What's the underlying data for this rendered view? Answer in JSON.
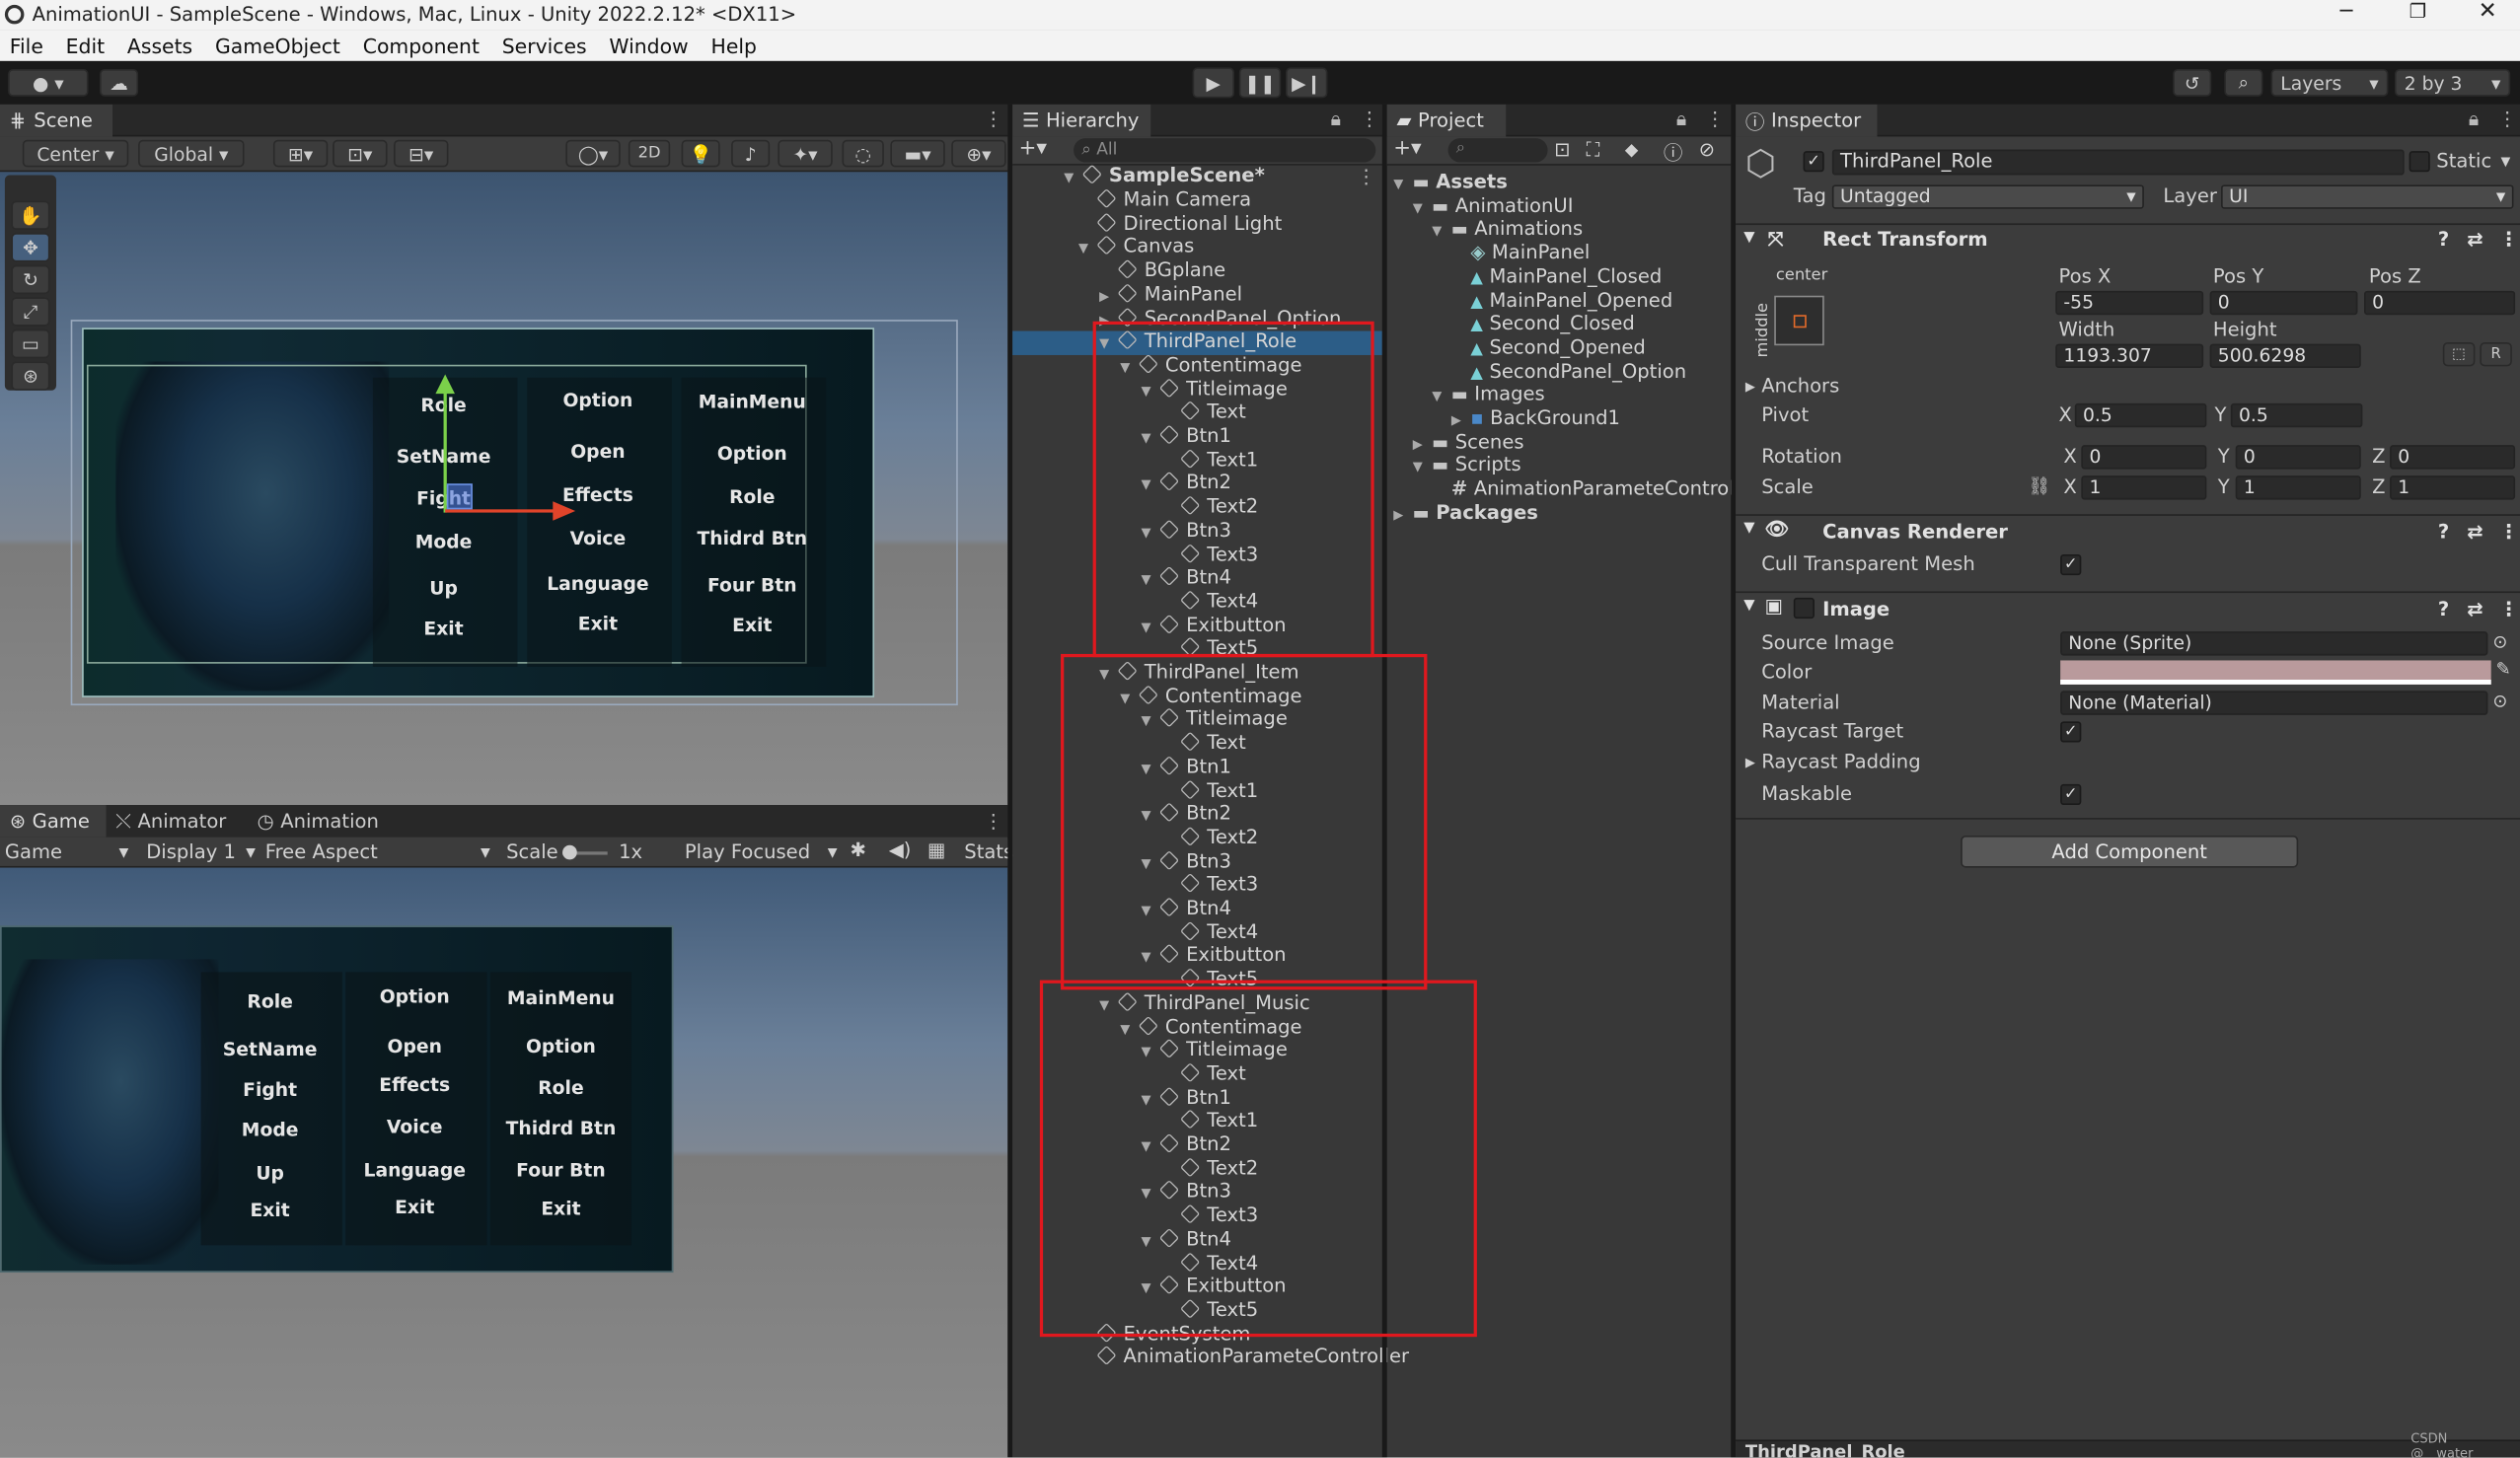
{
  "window": {
    "title": "AnimationUI - SampleScene - Windows, Mac, Linux - Unity 2022.2.12* <DX11>"
  },
  "menu": [
    "File",
    "Edit",
    "Assets",
    "GameObject",
    "Component",
    "Services",
    "Window",
    "Help"
  ],
  "toolbar": {
    "layers": "Layers",
    "layout": "2 by 3"
  },
  "scene": {
    "tab": "Scene",
    "pivot": "Center",
    "space": "Global",
    "mode2d": "2D"
  },
  "scene_ui": {
    "col1": [
      "Role",
      "SetName",
      "Fight",
      "Mode",
      "Up",
      "Exit"
    ],
    "col2": [
      "Option",
      "Open",
      "Effects",
      "Voice",
      "Language",
      "Exit"
    ],
    "col3": [
      "MainMenu",
      "Option",
      "Role",
      "Thidrd Btn",
      "Four Btn",
      "Exit"
    ]
  },
  "game": {
    "tabs": [
      "Game",
      "Animator",
      "Animation"
    ],
    "mode": "Game",
    "display": "Display 1",
    "aspect": "Free Aspect",
    "scale_label": "Scale",
    "scale_value": "1x",
    "play": "Play Focused",
    "stats": "Stats"
  },
  "hierarchy": {
    "tab": "Hierarchy",
    "search": "All",
    "scene": "SampleScene*",
    "items": [
      "Main Camera",
      "Directional Light",
      "Canvas",
      "BGplane",
      "MainPanel",
      "SecondPanel_Option",
      "ThirdPanel_Role",
      "Contentimage",
      "Titleimage",
      "Text",
      "Btn1",
      "Text1",
      "Btn2",
      "Text2",
      "Btn3",
      "Text3",
      "Btn4",
      "Text4",
      "Exitbutton",
      "Text5",
      "ThirdPanel_Item",
      "Contentimage",
      "Titleimage",
      "Text",
      "Btn1",
      "Text1",
      "Btn2",
      "Text2",
      "Btn3",
      "Text3",
      "Btn4",
      "Text4",
      "Exitbutton",
      "Text5",
      "ThirdPanel_Music",
      "Contentimage",
      "Titleimage",
      "Text",
      "Btn1",
      "Text1",
      "Btn2",
      "Text2",
      "Btn3",
      "Text3",
      "Btn4",
      "Text4",
      "Exitbutton",
      "Text5",
      "EventSystem",
      "AnimationParameteController"
    ]
  },
  "project": {
    "tab": "Project",
    "items": [
      "Assets",
      "AnimationUI",
      "Animations",
      "MainPanel",
      "MainPanel_Closed",
      "MainPanel_Opened",
      "Second_Closed",
      "Second_Opened",
      "SecondPanel_Option",
      "Images",
      "BackGround1",
      "Scenes",
      "Scripts",
      "AnimationParameteController",
      "Packages"
    ]
  },
  "inspector": {
    "tab": "Inspector",
    "name": "ThirdPanel_Role",
    "static": "Static",
    "tag_label": "Tag",
    "tag": "Untagged",
    "layer_label": "Layer",
    "layer": "UI",
    "rect": {
      "title": "Rect Transform",
      "anchor_h": "center",
      "anchor_v": "middle",
      "posx_label": "Pos X",
      "posy_label": "Pos Y",
      "posz_label": "Pos Z",
      "posx": "-55",
      "posy": "0",
      "posz": "0",
      "width_label": "Width",
      "height_label": "Height",
      "width": "1193.307",
      "height": "500.6298",
      "anchors": "Anchors",
      "pivot": "Pivot",
      "pivot_x": "0.5",
      "pivot_y": "0.5",
      "rotation": "Rotation",
      "rot_x": "0",
      "rot_y": "0",
      "rot_z": "0",
      "scale": "Scale",
      "scale_x": "1",
      "scale_y": "1",
      "scale_z": "1",
      "x": "X",
      "y": "Y",
      "z": "Z",
      "r": "R"
    },
    "canvas_renderer": {
      "title": "Canvas Renderer",
      "cull": "Cull Transparent Mesh"
    },
    "image": {
      "title": "Image",
      "source_label": "Source Image",
      "source": "None (Sprite)",
      "color_label": "Color",
      "color": "#b99a9c",
      "material_label": "Material",
      "material": "None (Material)",
      "raycast": "Raycast Target",
      "padding": "Raycast Padding",
      "maskable": "Maskable"
    },
    "add_component": "Add Component",
    "footer": "ThirdPanel_Role"
  },
  "watermark": "CSDN @__water_"
}
